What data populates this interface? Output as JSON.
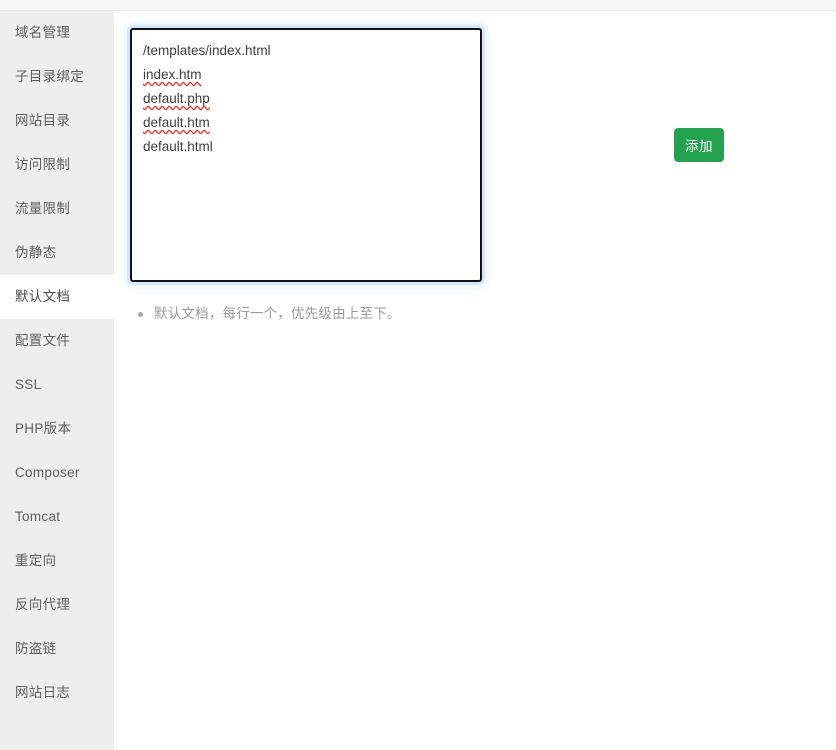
{
  "sidebar": {
    "active_index": 6,
    "items": [
      {
        "label": "域名管理"
      },
      {
        "label": "子目录绑定"
      },
      {
        "label": "网站目录"
      },
      {
        "label": "访问限制"
      },
      {
        "label": "流量限制"
      },
      {
        "label": "伪静态"
      },
      {
        "label": "默认文档"
      },
      {
        "label": "配置文件"
      },
      {
        "label": "SSL"
      },
      {
        "label": "PHP版本"
      },
      {
        "label": "Composer"
      },
      {
        "label": "Tomcat"
      },
      {
        "label": "重定向"
      },
      {
        "label": "反向代理"
      },
      {
        "label": "防盗链"
      },
      {
        "label": "网站日志"
      }
    ]
  },
  "main": {
    "editor": {
      "value": "/templates/index.html\nindex.htm\ndefault.php\ndefault.htm\ndefault.html",
      "placeholder": "",
      "lines": [
        {
          "text": "/templates/index.html",
          "misspelled": false
        },
        {
          "text": "index.htm",
          "misspelled": true
        },
        {
          "text": "default.php",
          "misspelled": true
        },
        {
          "text": "default.htm",
          "misspelled": true
        },
        {
          "text": "default.html",
          "misspelled": false
        }
      ]
    },
    "add_button_label": "添加",
    "hints": [
      {
        "text": "默认文档，每行一个，优先级由上至下。"
      }
    ]
  },
  "colors": {
    "accent_green": "#23a24d",
    "sidebar_bg": "#eeeeee",
    "active_bg": "#ffffff",
    "focus_glow": "#cee5fa",
    "spellcheck_underline": "#e8362a",
    "text_muted": "#9a9a9a"
  }
}
